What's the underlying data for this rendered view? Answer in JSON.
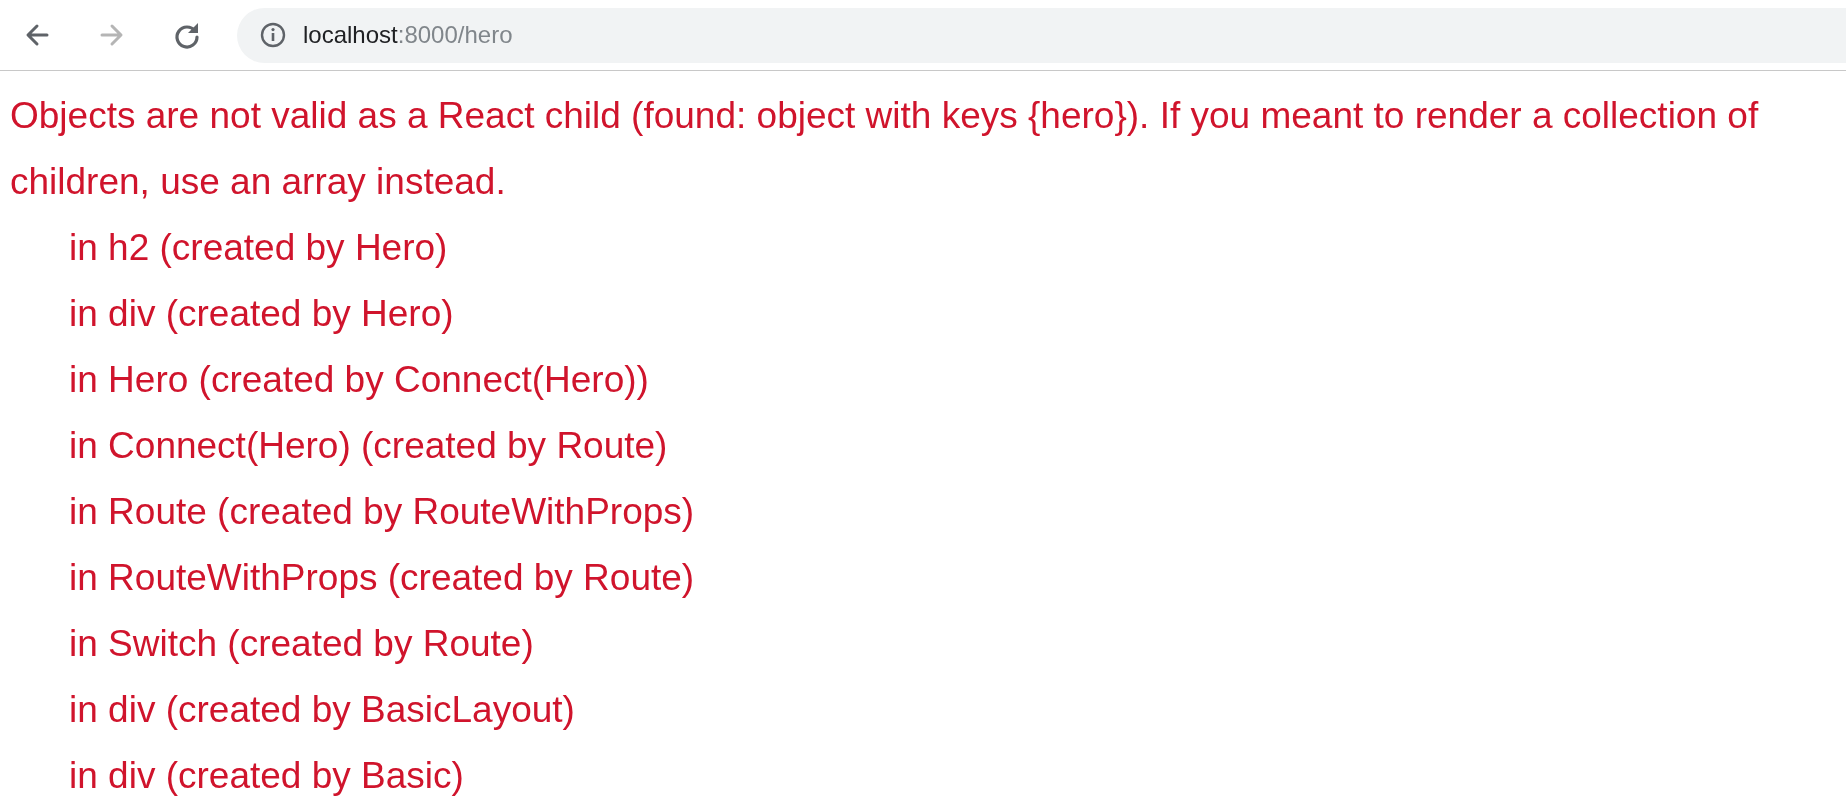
{
  "toolbar": {
    "back": {
      "disabled": false
    },
    "forward": {
      "disabled": true
    },
    "address": {
      "host": "localhost",
      "rest": ":8000/hero"
    }
  },
  "error": {
    "message": "Objects are not valid as a React child (found: object with keys {hero}). If you meant to render a collection of children, use an array instead.",
    "stack": [
      "in h2 (created by Hero)",
      "in div (created by Hero)",
      "in Hero (created by Connect(Hero))",
      "in Connect(Hero) (created by Route)",
      "in Route (created by RouteWithProps)",
      "in RouteWithProps (created by Route)",
      "in Switch (created by Route)",
      "in div (created by BasicLayout)",
      "in div (created by Basic)"
    ]
  }
}
